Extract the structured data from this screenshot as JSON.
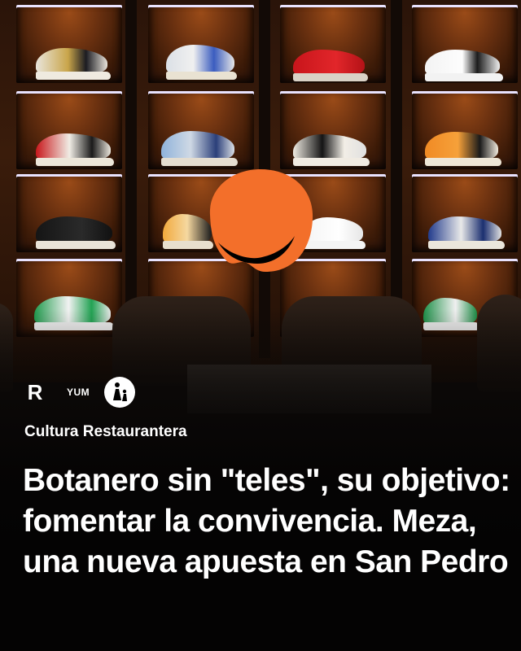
{
  "post": {
    "brand_r": "R",
    "brand_yum": "YUM",
    "section_label": "Cultura Restaurantera",
    "headline": "Botanero sin \"teles\", su objetivo: fomentar la convivencia. Meza, una nueva apuesta en San Pedro"
  },
  "colors": {
    "blob": "#f36f2a",
    "text": "#ffffff",
    "wood": "#6b3110",
    "background": "#040303"
  },
  "icons": {
    "logo": "orange-smile-blob-icon",
    "family": "parent-child-icon"
  }
}
